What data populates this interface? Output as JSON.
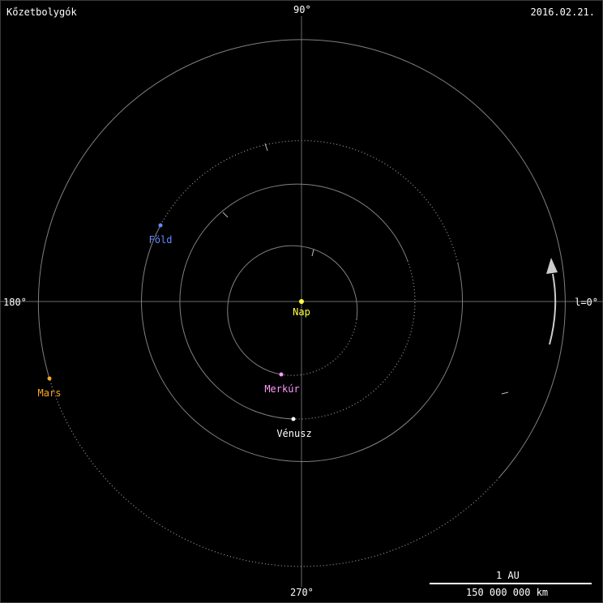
{
  "header": {
    "title": "Kőzetbolygók",
    "date": "2016.02.21."
  },
  "axes": {
    "top": "90°",
    "left": "180°",
    "right": "l=0°",
    "bottom": "270°"
  },
  "planets": {
    "sun": {
      "name": "Nap",
      "color": "#ffff44"
    },
    "mercury": {
      "name": "Merkúr",
      "color": "#ff99ff"
    },
    "venus": {
      "name": "Vénusz",
      "color": "#ffffff"
    },
    "earth": {
      "name": "Föld",
      "color": "#6688ff"
    },
    "mars": {
      "name": "Mars",
      "color": "#ffaa22"
    }
  },
  "scale": {
    "label": "1 AU",
    "value": "150 000 000 km"
  },
  "colors": {
    "background": "#000000",
    "orbit": "#808080",
    "axis": "#6a6a6a",
    "arrow": "#cccccc"
  }
}
